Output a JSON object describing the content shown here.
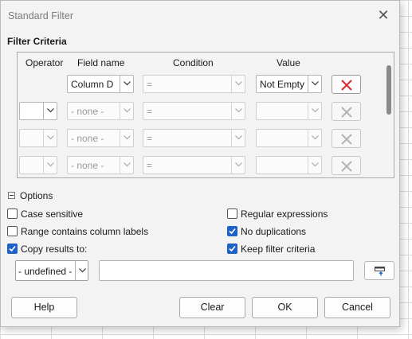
{
  "window": {
    "title": "Standard Filter"
  },
  "section_label": "Filter Criteria",
  "headers": {
    "operator": "Operator",
    "field_name": "Field name",
    "condition": "Condition",
    "value": "Value"
  },
  "rows": [
    {
      "operator": "",
      "field": "Column D",
      "condition": "=",
      "value": "Not Empty"
    },
    {
      "operator": "",
      "field": "- none -",
      "condition": "=",
      "value": ""
    },
    {
      "operator": "",
      "field": "- none -",
      "condition": "=",
      "value": ""
    },
    {
      "operator": "",
      "field": "- none -",
      "condition": "=",
      "value": ""
    }
  ],
  "options": {
    "label": "Options",
    "case_sensitive": {
      "label": "Case sensitive",
      "checked": false
    },
    "regular_expressions": {
      "label": "Regular expressions",
      "checked": false
    },
    "range_contains_labels": {
      "label": "Range contains column labels",
      "checked": false
    },
    "no_duplications": {
      "label": "No duplications",
      "checked": true
    },
    "copy_results": {
      "label": "Copy results to:",
      "checked": true
    },
    "keep_filter": {
      "label": "Keep filter criteria",
      "checked": true
    },
    "copy_target_select": "- undefined -",
    "copy_target_input": ""
  },
  "buttons": {
    "help": "Help",
    "clear": "Clear",
    "ok": "OK",
    "cancel": "Cancel"
  },
  "colors": {
    "accent": "#1e62c8",
    "delete_active": "#d92b2b"
  }
}
